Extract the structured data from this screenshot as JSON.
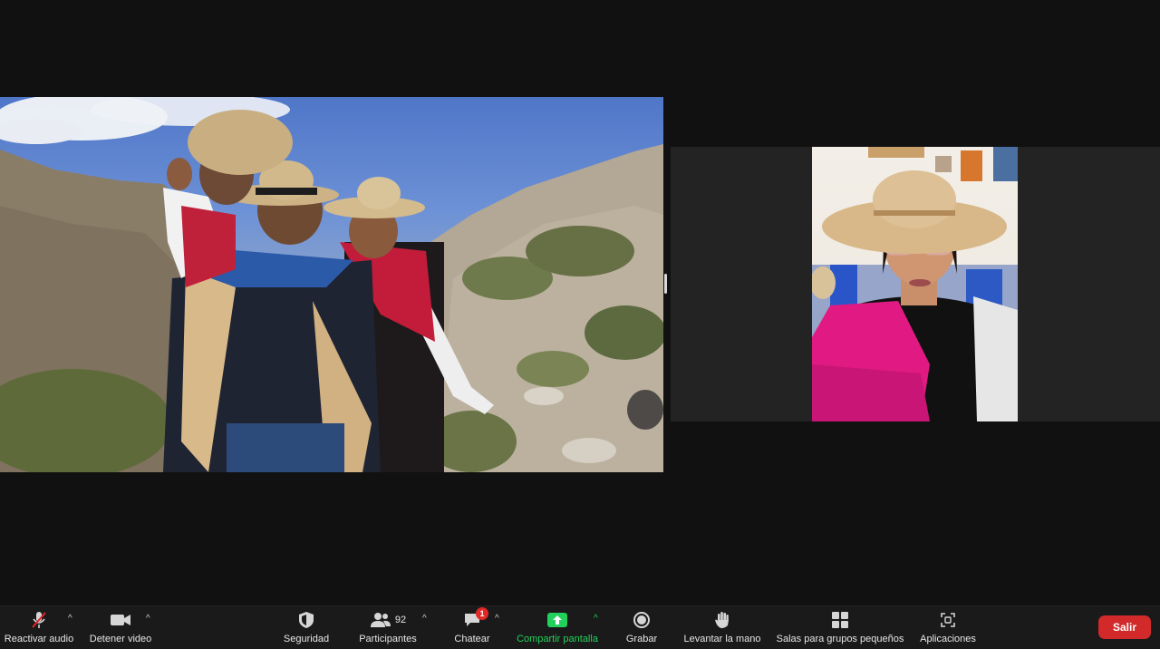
{
  "app": {
    "name": "Zoom meeting"
  },
  "toolbar": {
    "unmute_label": "Reactivar audio",
    "stop_video_label": "Detener video",
    "security_label": "Seguridad",
    "participants_label": "Participantes",
    "participants_count": "92",
    "chat_label": "Chatear",
    "chat_badge": "1",
    "share_label": "Compartir pantalla",
    "record_label": "Grabar",
    "raise_hand_label": "Levantar la mano",
    "breakout_label": "Salas para grupos pequeños",
    "apps_label": "Aplicaciones",
    "leave_label": "Salir",
    "caret_glyph": "^"
  },
  "colors": {
    "background": "#111111",
    "toolbar": "#1a1a1a",
    "share_green": "#22d15c",
    "leave_red": "#d22a2a",
    "badge_red": "#e02828"
  },
  "icons": [
    "muted-mic-icon",
    "video-camera-icon",
    "shield-icon",
    "participants-icon",
    "chat-bubble-icon",
    "share-screen-icon",
    "record-icon",
    "raise-hand-icon",
    "breakout-rooms-icon",
    "apps-icon"
  ]
}
